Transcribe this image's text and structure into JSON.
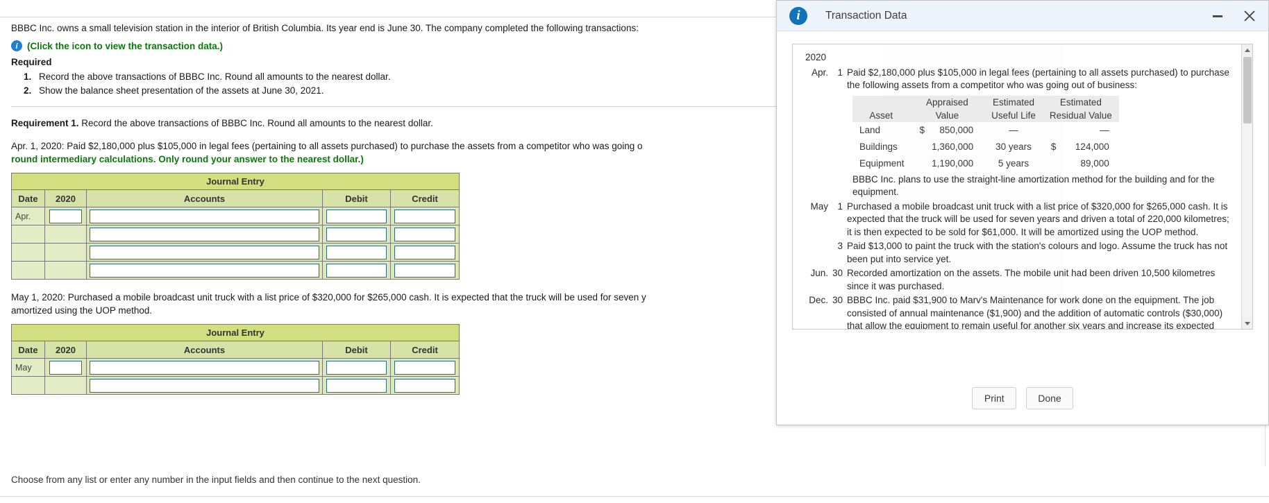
{
  "worksheet": {
    "intro": "BBBC Inc. owns a small television station in the interior of British Columbia. Its year end is June 30. The company completed the following transactions:",
    "icon_link_text": "(Click the icon to view the transaction data.)",
    "required_heading": "Required",
    "requirements": [
      {
        "num": "1.",
        "text": "Record the above transactions of BBBC Inc. Round all amounts to the nearest dollar."
      },
      {
        "num": "2.",
        "text": "Show the balance sheet presentation of the assets at June 30, 2021."
      }
    ],
    "requirement1_label": "Requirement 1.",
    "requirement1_text": "Record the above transactions of BBBC Inc. Round all amounts to the nearest dollar.",
    "entry1": {
      "line1": "Apr. 1, 2020: Paid $2,180,000 plus $105,000 in legal fees (pertaining to all assets purchased) to purchase the assets from a competitor who was going o",
      "line2_green": "round intermediary calculations. Only round your answer to the nearest dollar.)"
    },
    "entry2": {
      "line1": "May 1, 2020: Purchased a mobile broadcast unit truck with a list price of $320,000 for $265,000 cash. It is expected that the truck will be used for seven y",
      "line2": "amortized using the UOP method."
    },
    "journal": {
      "title": "Journal Entry",
      "headers": {
        "date": "Date",
        "year": "2020",
        "accounts": "Accounts",
        "debit": "Debit",
        "credit": "Credit"
      },
      "entry1_rows": [
        {
          "month": "Apr."
        },
        {
          "month": ""
        },
        {
          "month": ""
        },
        {
          "month": ""
        }
      ],
      "entry2_rows": [
        {
          "month": "May"
        },
        {
          "month": ""
        }
      ]
    },
    "bottom_status": "Choose from any list or enter any number in the input fields and then continue to the next question."
  },
  "dialog": {
    "title": "Transaction Data",
    "info_glyph": "i",
    "minimize_label": "Minimize",
    "close_label": "Close",
    "year": "2020",
    "transactions": [
      {
        "month": "Apr.",
        "day": "1",
        "text": "Paid $2,180,000 plus $105,000 in legal fees (pertaining to all assets purchased) to purchase the following assets from a competitor who was going out of business:",
        "has_table": true,
        "note": "BBBC Inc. plans to use the straight-line amortization method for the building and for the equipment."
      },
      {
        "month": "May",
        "day": "1",
        "text": "Purchased a mobile broadcast unit truck with a list price of $320,000 for $265,000 cash. It is expected that the truck will be used for seven years and driven a total of 220,000 kilometres; it is then expected to be sold for $61,000. It will be amortized using the UOP method."
      },
      {
        "month": "",
        "day": "3",
        "text": "Paid $13,000 to paint the truck with the station's colours and logo. Assume the truck has not been put into service yet."
      },
      {
        "month": "Jun.",
        "day": "30",
        "text": "Recorded amortization on the assets. The mobile unit had been driven 10,500 kilometres since it was purchased."
      },
      {
        "month": "Dec.",
        "day": "30",
        "text": "BBBC Inc. paid $31,900 to Marv's Maintenance for work done on the equipment. The job consisted of annual maintenance ($1,900) and the addition of automatic controls ($30,000) that allow the equipment to remain useful for another six years and increase its expected residual"
      }
    ],
    "asset_table": {
      "headers_top": [
        "",
        "Appraised",
        "Estimated",
        "Estimated"
      ],
      "headers_bottom": [
        "Asset",
        "Value",
        "Useful Life",
        "Residual Value"
      ],
      "rows": [
        {
          "asset": "Land",
          "currency": "$",
          "value": "850,000",
          "life": "—",
          "res_currency": "",
          "residual": "—"
        },
        {
          "asset": "Buildings",
          "currency": "",
          "value": "1,360,000",
          "life": "30 years",
          "res_currency": "$",
          "residual": "124,000"
        },
        {
          "asset": "Equipment",
          "currency": "",
          "value": "1,190,000",
          "life": "5 years",
          "res_currency": "",
          "residual": "89,000"
        }
      ]
    },
    "footer": {
      "print_label": "Print",
      "done_label": "Done"
    }
  },
  "colors": {
    "accent_blue": "#1272b8",
    "green_text": "#0b7a0b",
    "table_title_bg": "#d3de80",
    "table_head_bg": "#d7e3a6",
    "table_row_bg": "#dde8b5",
    "dialog_title_bg": "#eef4fb"
  }
}
